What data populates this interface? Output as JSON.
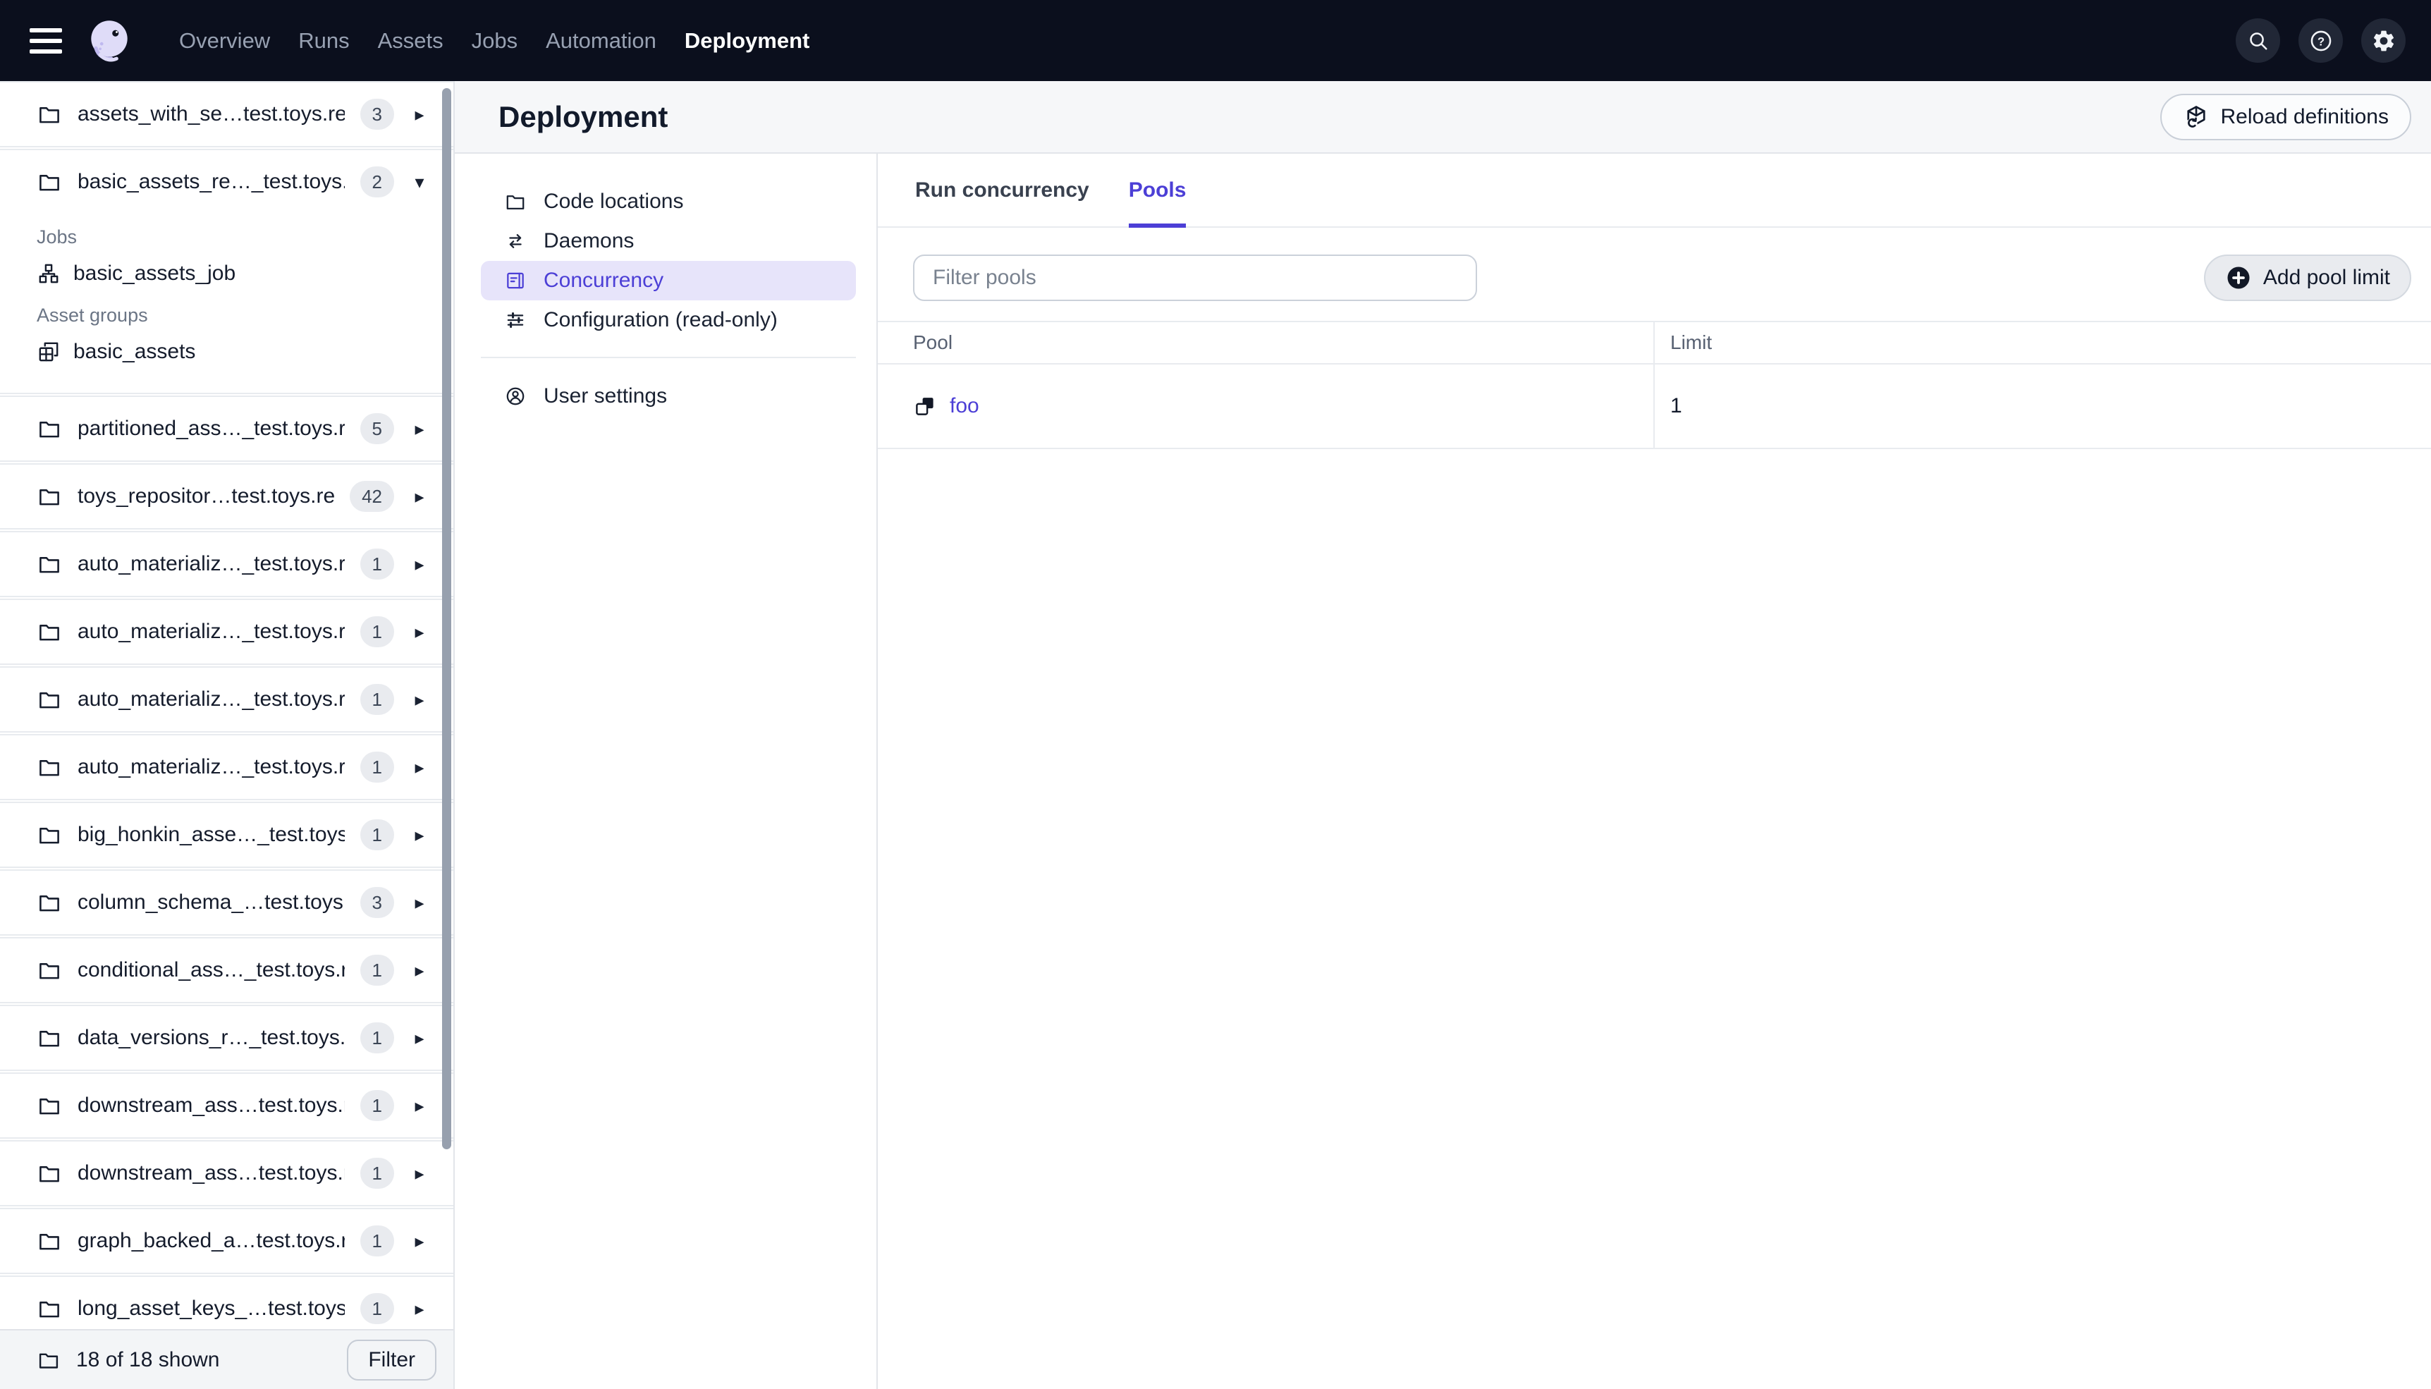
{
  "topnav": {
    "items": [
      {
        "label": "Overview",
        "active": false
      },
      {
        "label": "Runs",
        "active": false
      },
      {
        "label": "Assets",
        "active": false
      },
      {
        "label": "Jobs",
        "active": false
      },
      {
        "label": "Automation",
        "active": false
      },
      {
        "label": "Deployment",
        "active": true
      }
    ],
    "actions": [
      {
        "icon": "search-icon"
      },
      {
        "icon": "help-icon"
      },
      {
        "icon": "settings-icon"
      }
    ]
  },
  "sidebar": {
    "items": [
      {
        "label": "assets_with_se…test.toys.repo",
        "count": 3,
        "expanded": false
      },
      {
        "label": "basic_assets_re…_test.toys.rep",
        "count": 2,
        "expanded": true,
        "sections": [
          {
            "label": "Jobs",
            "items": [
              {
                "icon": "job-icon",
                "label": "basic_assets_job"
              }
            ]
          },
          {
            "label": "Asset groups",
            "items": [
              {
                "icon": "asset-group-icon",
                "label": "basic_assets"
              }
            ]
          }
        ]
      },
      {
        "label": "partitioned_ass…_test.toys.rep",
        "count": 5,
        "expanded": false
      },
      {
        "label": "toys_repositor…test.toys.repo",
        "count": 42,
        "expanded": false
      },
      {
        "label": "auto_materializ…_test.toys.repo",
        "count": 1,
        "expanded": false
      },
      {
        "label": "auto_materializ…_test.toys.repo",
        "count": 1,
        "expanded": false
      },
      {
        "label": "auto_materializ…_test.toys.repo",
        "count": 1,
        "expanded": false
      },
      {
        "label": "auto_materializ…_test.toys.repo",
        "count": 1,
        "expanded": false
      },
      {
        "label": "big_honkin_asse…_test.toys.rep",
        "count": 1,
        "expanded": false
      },
      {
        "label": "column_schema_…test.toys.rep",
        "count": 3,
        "expanded": false
      },
      {
        "label": "conditional_ass…_test.toys.repo",
        "count": 1,
        "expanded": false
      },
      {
        "label": "data_versions_r…_test.toys.rep",
        "count": 1,
        "expanded": false
      },
      {
        "label": "downstream_ass…test.toys.rep",
        "count": 1,
        "expanded": false
      },
      {
        "label": "downstream_ass…test.toys.rep",
        "count": 1,
        "expanded": false
      },
      {
        "label": "graph_backed_a…test.toys.repo",
        "count": 1,
        "expanded": false
      },
      {
        "label": "long_asset_keys_…test.toys.rep",
        "count": 1,
        "expanded": false
      }
    ],
    "footer": {
      "count_text": "18 of 18 shown",
      "filter_label": "Filter"
    }
  },
  "main": {
    "title": "Deployment",
    "reload_label": "Reload definitions",
    "nav_groups": [
      [
        {
          "icon": "folder-icon",
          "label": "Code locations",
          "active": false
        },
        {
          "icon": "daemons-icon",
          "label": "Daemons",
          "active": false
        },
        {
          "icon": "concurrency-icon",
          "label": "Concurrency",
          "active": true
        },
        {
          "icon": "config-icon",
          "label": "Configuration (read-only)",
          "active": false
        }
      ],
      [
        {
          "icon": "user-icon",
          "label": "User settings",
          "active": false
        }
      ]
    ],
    "tabs": [
      {
        "label": "Run concurrency",
        "active": false
      },
      {
        "label": "Pools",
        "active": true
      }
    ],
    "filter_placeholder": "Filter pools",
    "add_label": "Add pool limit",
    "table": {
      "columns": [
        "Pool",
        "Limit"
      ],
      "rows": [
        {
          "icon": "pool-icon",
          "pool": "foo",
          "limit": "1"
        }
      ]
    }
  },
  "colors": {
    "topnav_bg": "#0B0F1D",
    "accent": "#4C3FD6",
    "accent_bg": "#E7E4FA",
    "badge_bg": "#E9EBEF",
    "header_bg": "#F6F7F9",
    "border": "#E8EBEF",
    "text": "#151C2C",
    "muted": "#6B7585"
  }
}
